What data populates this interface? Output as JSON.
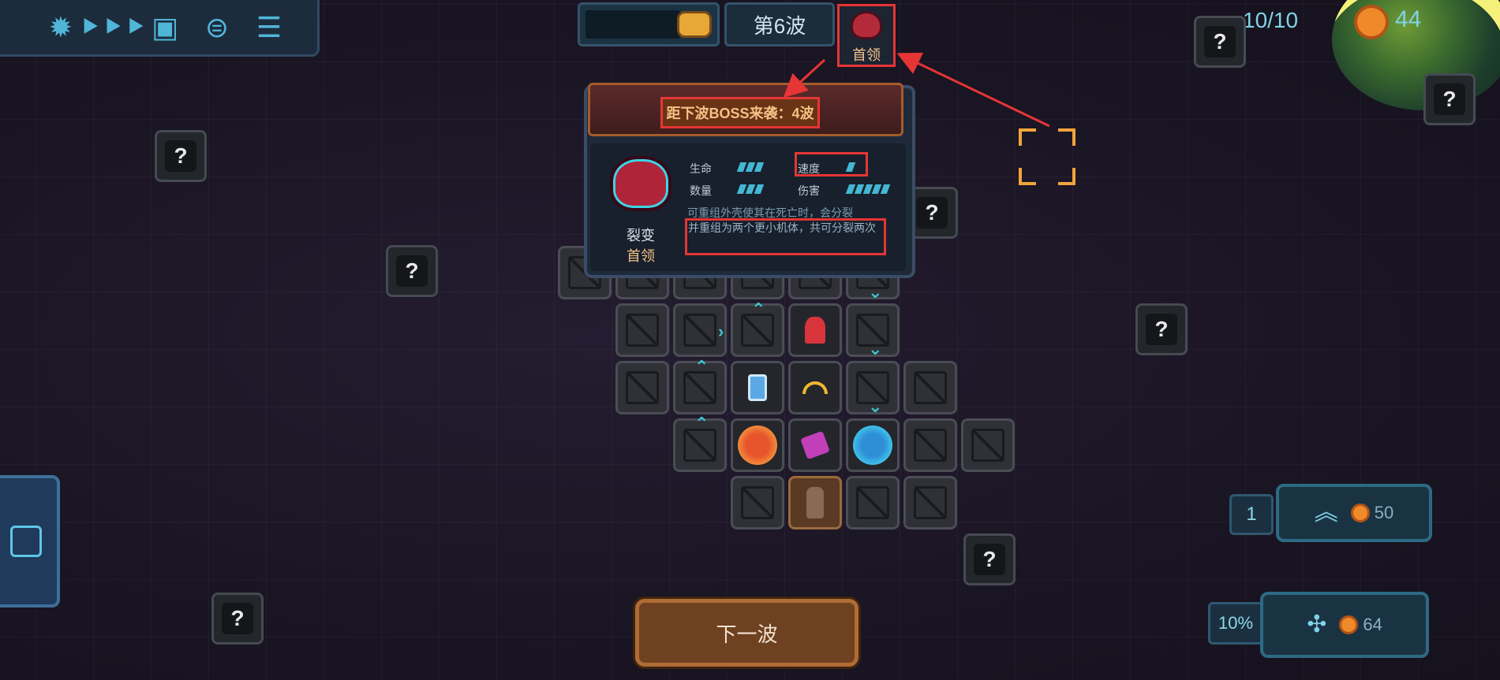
{
  "toolbar": {
    "buttons": [
      {
        "name": "settings",
        "icon": "gear-icon"
      },
      {
        "name": "speed",
        "icon": "fast-forward-icon"
      },
      {
        "name": "help",
        "icon": "question-card-icon"
      },
      {
        "name": "map",
        "icon": "planet-icon"
      },
      {
        "name": "menu",
        "icon": "list-icon"
      }
    ]
  },
  "wave": {
    "label": "第6波",
    "boss_label": "首领",
    "wave_icon": "enemy-wave-icon"
  },
  "status": {
    "hp": "10/10",
    "coins": "44"
  },
  "mystery_glyph": "?",
  "popup": {
    "title": "距下波BOSS来袭：4波",
    "boss_name": "裂变",
    "boss_tier": "首领",
    "stats": [
      {
        "label": "生命",
        "level": 3
      },
      {
        "label": "速度",
        "level": 1
      },
      {
        "label": "数量",
        "level": 3
      },
      {
        "label": "伤害",
        "level": 5
      }
    ],
    "description_line1": "可重组外壳使其在死亡时，会分裂",
    "description_line2": "并重组为两个更小机体，共可分裂两次"
  },
  "bottom": {
    "next_wave": "下一波",
    "upgrade_level": "1",
    "upgrade_cost": "50",
    "build_pct": "10%",
    "build_cost": "64"
  },
  "colors": {
    "accent": "#4fb6d8",
    "highlight": "#e53535",
    "coin": "#ee8a2a",
    "gold_text": "#f2c186"
  }
}
